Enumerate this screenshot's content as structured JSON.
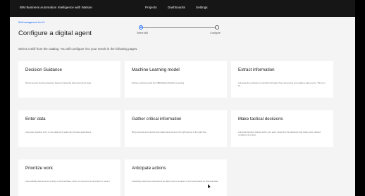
{
  "header": {
    "brand": "IBM Business Automation Intelligence with Watson",
    "nav": [
      "Projects",
      "Dashboards",
      "Settings"
    ]
  },
  "breadcrumb": "Skill management for UX",
  "page": {
    "title": "Configure a digital agent",
    "subtitle": "Select a skill from the catalog. You will configure it to your needs in the following pages."
  },
  "stepper": {
    "steps": [
      "Select skill",
      "Configure"
    ]
  },
  "tiles": [
    {
      "title": "Decision Guidance",
      "desc": "Recommend a business decision based on historical data and current state."
    },
    {
      "title": "Machine Learning model",
      "desc": "Embed a trained model from IBM Watson Machine Learning."
    },
    {
      "title": "Extract information",
      "desc": "Automate the extraction of specific information from documents and update a data source. This is to be..."
    },
    {
      "title": "Enter data",
      "desc": "Automate repetitive entry of new data entry tasks into business applications."
    },
    {
      "title": "Gather critical information",
      "desc": "Bring relevant and relevant and related documents to the right person in the right time."
    },
    {
      "title": "Make tactical decisions",
      "desc": "Automate decision making within your team. Determine the decisions that matter given defined conditions & context."
    },
    {
      "title": "Prioritize work",
      "desc": "Automatically determine the priority of work activities, where to route work to and when to route it."
    },
    {
      "title": "Anticipate actions",
      "desc": "Proactively determine what actions are likely next to be taken in a Process based on historical data."
    }
  ],
  "colors": {
    "topbar": "#161616",
    "accent": "#0f62fe",
    "page_bg": "#f4f4f4",
    "tile_bg": "#ffffff"
  }
}
